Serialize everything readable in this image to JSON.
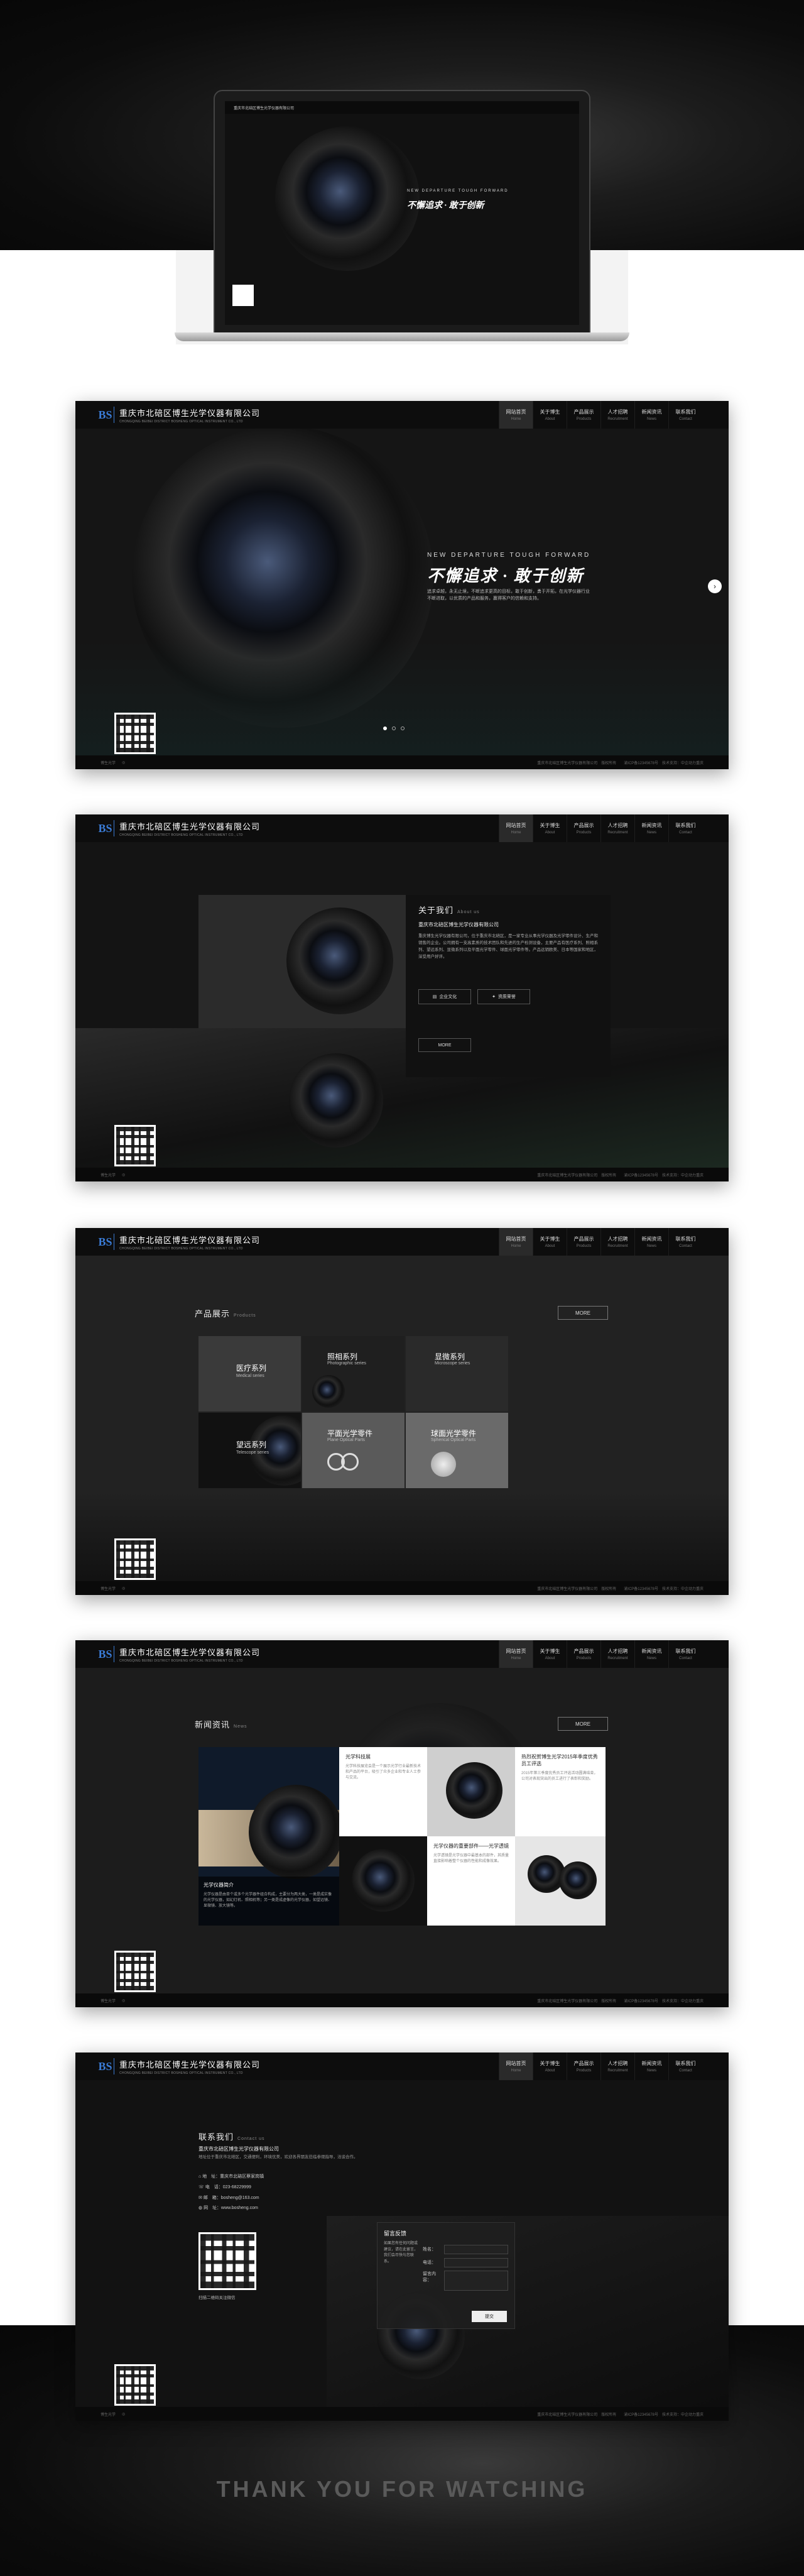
{
  "company": {
    "name_cn": "重庆市北碚区博生光学仪器有限公司",
    "name_en": "CHONGQING BEIBEI DISTRICT BOSHENG OPTICAL INSTRUMENT CO., LTD"
  },
  "nav": [
    {
      "cn": "网站首页",
      "en": "Home"
    },
    {
      "cn": "关于博生",
      "en": "About"
    },
    {
      "cn": "产品展示",
      "en": "Products"
    },
    {
      "cn": "人才招聘",
      "en": "Recruitment"
    },
    {
      "cn": "新闻资讯",
      "en": "News"
    },
    {
      "cn": "联系我们",
      "en": "Contact"
    }
  ],
  "hero": {
    "tagline_en": "NEW DEPARTURE    TOUGH FORWARD",
    "slogan_cn": "不懈追求 · 敢于创新",
    "desc": "追求卓越，永无止境，不断追求更高的目标，敢于创新，勇于开拓，在光学仪器行业不断进取，以优质的产品和服务，赢得客户的信赖和支持。"
  },
  "footer": {
    "left": "博生光学",
    "right": "重庆市北碚区博生光学仪器有限公司　版权所有　　渝ICP备12345678号　技术支持：中企动力重庆"
  },
  "about": {
    "title": "关于我们",
    "title_en": "About us",
    "company": "重庆市北碚区博生光学仪器有限公司",
    "text": "重庆博生光学仪器有限公司，位于重庆市北碚区，是一家专业从事光学仪器及光学零件设计、生产和销售的企业。公司拥有一支高素质的技术团队和先进的生产检测设备，主要产品有医疗系列、照相系列、望远系列、显微系列以及平面光学零件、球面光学零件等。产品远销欧美、日本等国家和地区，深受用户好评。",
    "btn1": "企业文化",
    "btn2": "资质荣誉",
    "more": "MORE"
  },
  "products": {
    "title": "产品展示",
    "title_en": "Products",
    "more": "MORE",
    "items": [
      {
        "cn": "医疗系列",
        "en": "Medical series"
      },
      {
        "cn": "照相系列",
        "en": "Photographic series"
      },
      {
        "cn": "显微系列",
        "en": "Microscope series"
      },
      {
        "cn": "望远系列",
        "en": "Telescope series"
      },
      {
        "cn": "平面光学零件",
        "en": "Plane Optical Parts"
      },
      {
        "cn": "球面光学零件",
        "en": "Spherical Optical Parts"
      }
    ]
  },
  "news": {
    "title": "新闻资讯",
    "title_en": "News",
    "more": "MORE",
    "items": [
      {
        "title": "光学仪器简介",
        "text": "光学仪器是由单个或多个光学器件组合构成，主要分为两大类，一类是成实像的光学仪器，如幻灯机、照相机等；另一类是成虚像的光学仪器，如望远镜、显微镜、放大镜等。"
      },
      {
        "title": "光学科技展",
        "text": "光学科技展览会是一个展示光学行业最新技术和产品的平台，吸引了众多企业和专业人士参与交流。"
      },
      {
        "title": "热烈祝贺博生光学2015年季度优秀员工评选",
        "text": "2015年第三季度优秀员工评选活动圆满结束，公司对表现突出的员工进行了表彰和奖励。"
      },
      {
        "title": "光学仪器的重要部件——光学透镜",
        "text": "光学透镜是光学仪器中最基本的部件，其质量直接影响着整个仪器的性能和成像效果。"
      }
    ]
  },
  "contact": {
    "title": "联系我们",
    "title_en": "Contact us",
    "company": "重庆市北碚区博生光学仪器有限公司",
    "desc": "地址位于重庆市北碚区，交通便利，环境优美，欢迎各界朋友莅临参观指导，洽谈合作。",
    "address": "地　址：重庆市北碚区蔡家岗镇",
    "phone": "电　话：023-68229999",
    "email": "邮　箱：bosheng@163.com",
    "web": "网　址：www.bosheng.com",
    "qr_caption": "扫描二维码关注微信",
    "form_title": "留言反馈",
    "form_desc": "如果您有任何问题或建议，请在此留言，我们会尽快与您联系。",
    "name_label": "姓名：",
    "phone_label": "电话：",
    "msg_label": "留言内容：",
    "submit": "提交"
  },
  "thanks": "THANK YOU FOR WATCHING"
}
